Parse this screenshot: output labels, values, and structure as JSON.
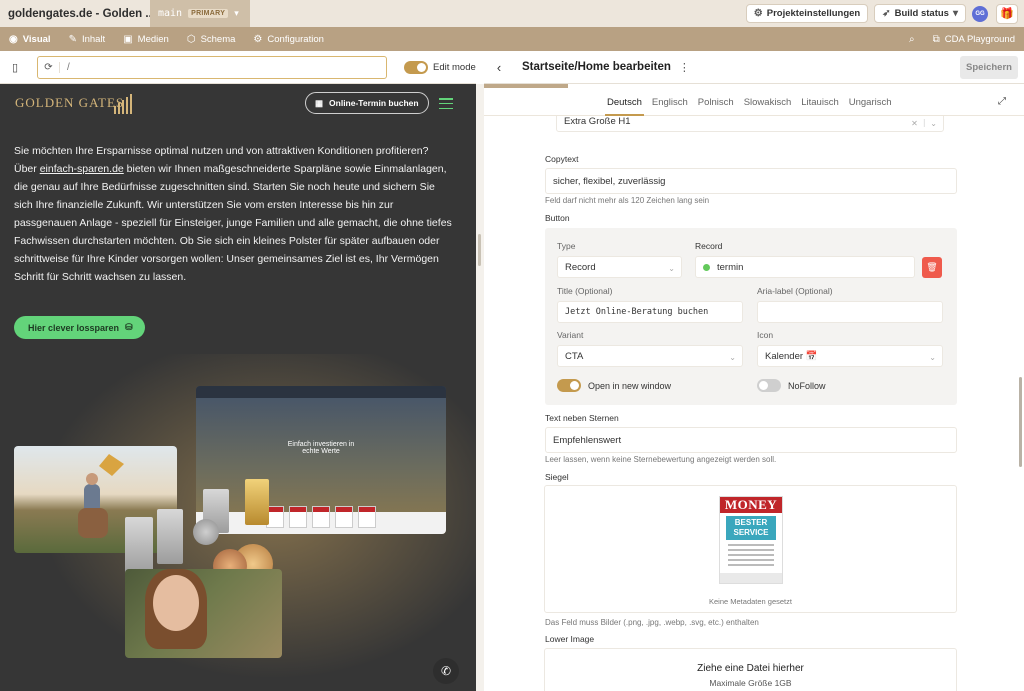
{
  "topbar": {
    "site_title": "goldengates.de - Golden ...",
    "branch": "main",
    "branch_badge": "PRIMARY",
    "project_settings": "Projekteinstellungen",
    "build_status": "Build status",
    "avatar_initials": "GG"
  },
  "nav": {
    "items": [
      {
        "label": "Visual",
        "icon": "eye-icon"
      },
      {
        "label": "Inhalt",
        "icon": "edit-icon"
      },
      {
        "label": "Medien",
        "icon": "image-icon"
      },
      {
        "label": "Schema",
        "icon": "cube-icon"
      },
      {
        "label": "Configuration",
        "icon": "gear-icon"
      }
    ],
    "playground": "CDA Playground"
  },
  "preview_toolbar": {
    "url": "/",
    "edit_mode_label": "Edit mode",
    "edit_mode_on": true
  },
  "preview": {
    "logo": "GOLDEN GATES",
    "book_button": "Online-Termin buchen",
    "text_before_link": "Sie möchten Ihre Ersparnisse optimal nutzen und von attraktiven Konditionen profitieren? Über ",
    "link": "einfach-sparen.de",
    "text_after_link": " bieten wir Ihnen maßgeschneiderte Sparpläne sowie Einmalanlagen, die genau auf Ihre Bedürfnisse zugeschnitten sind. Starten Sie noch heute und sichern Sie sich Ihre finanzielle Zukunft. Wir unterstützen Sie vom ersten Interesse bis hin zur passgenauen Anlage - speziell für Einsteiger, junge Familien und alle gemacht, die ohne tiefes Fachwissen durchstarten möchten. Ob Sie sich ein kleines Polster für später aufbauen oder schrittweise für Ihre Kinder vorsorgen wollen: Unser gemeinsames Ziel ist es, Ihr Vermögen Schritt für Schritt wachsen zu lassen.",
    "cta": "Hier clever lossparen",
    "mockup_title_line1": "Einfach investieren in",
    "mockup_title_line2": "echte Werte"
  },
  "editor": {
    "title": "Startseite/Home bearbeiten",
    "save": "Speichern",
    "languages": [
      "Deutsch",
      "Englisch",
      "Polnisch",
      "Slowakisch",
      "Litauisch",
      "Ungarisch"
    ],
    "active_language": "Deutsch",
    "heading_size_value": "Extra Große H1",
    "copytext_label": "Copytext",
    "copytext_value": "sicher, flexibel, zuverlässig",
    "copytext_hint": "Feld darf nicht mehr als 120 Zeichen lang sein",
    "button_label": "Button",
    "button": {
      "type_label": "Type",
      "type_value": "Record",
      "record_label": "Record",
      "record_value": "termin",
      "title_label": "Title (Optional)",
      "title_value": "Jetzt Online-Beratung buchen",
      "aria_label": "Aria-label (Optional)",
      "aria_value": "",
      "variant_label": "Variant",
      "variant_value": "CTA",
      "icon_label": "Icon",
      "icon_value": "Kalender 📅",
      "new_window_label": "Open in new window",
      "new_window_on": true,
      "nofollow_label": "NoFollow",
      "nofollow_on": false
    },
    "stars_label": "Text neben Sternen",
    "stars_value": "Empfehlenswert",
    "stars_hint": "Leer lassen, wenn keine Sternebewertung angezeigt werden soll.",
    "seal_label": "Siegel",
    "seal": {
      "brand": "MONEY",
      "award_line1": "BESTER",
      "award_line2": "SERVICE",
      "meta": "Keine Metadaten gesetzt"
    },
    "seal_hint": "Das Feld muss Bilder (.png, .jpg, .webp, .svg, etc.) enthalten",
    "lower_image_label": "Lower Image",
    "drop_main": "Ziehe eine Datei hierher",
    "drop_sub": "Maximale Größe 1GB"
  },
  "colors": {
    "accent_gold": "#c49a4e",
    "nav_bg": "#b8a183",
    "preview_bg": "#363636",
    "cta_green": "#63d47a",
    "delete_red": "#ef5a4c"
  }
}
